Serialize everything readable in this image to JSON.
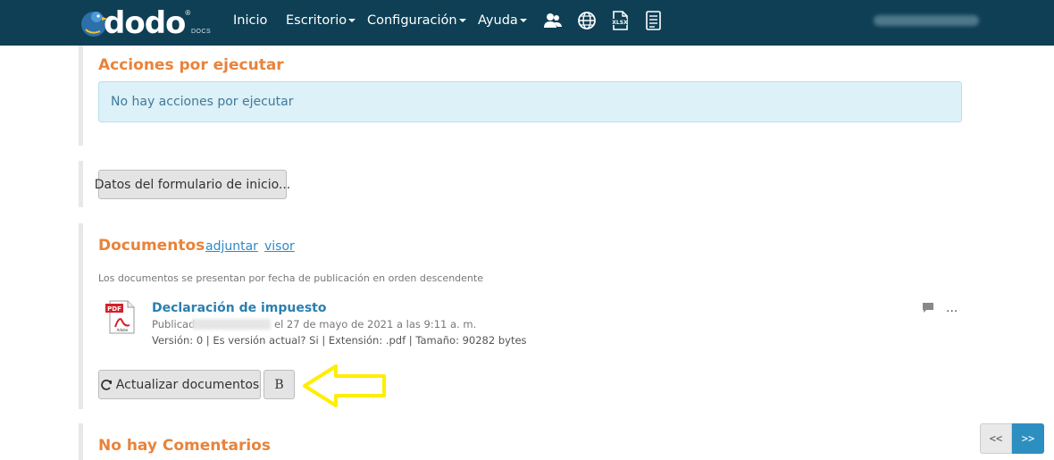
{
  "navbar": {
    "logo_text": "dodo",
    "logo_reg": "®",
    "logo_sub": "DOCS",
    "items": [
      {
        "label": "Inicio",
        "dropdown": false
      },
      {
        "label": "Escritorio",
        "dropdown": true
      },
      {
        "label": "Configuración",
        "dropdown": true
      },
      {
        "label": "Ayuda",
        "dropdown": true
      }
    ],
    "icons": [
      "users-icon",
      "globe-icon",
      "xlsx-icon",
      "document-list-icon"
    ],
    "background": "#0e3f55"
  },
  "acciones": {
    "title": "Acciones por ejecutar",
    "alert": "No hay acciones por ejecutar"
  },
  "form_button": {
    "label": "Datos del formulario de inicio..."
  },
  "documentos": {
    "title": "Documentos",
    "link_attach": "adjuntar",
    "link_viewer": "visor",
    "note": "Los documentos se presentan por fecha de publicación en orden descendente",
    "items": [
      {
        "title": "Declaración de impuesto",
        "published_prefix": "Publicad",
        "published_suffix": "el 27 de mayo de 2021 a las 9:11 a. m.",
        "meta": "Versión: 0 | Es versión actual? Si | Extensión: .pdf | Tamaño: 90282 bytes",
        "more": "..."
      }
    ],
    "refresh_button": "Actualizar documentos",
    "b_button": "B"
  },
  "comentarios": {
    "title": "No hay Comentarios"
  },
  "pager": {
    "prev": "<<",
    "next": ">>"
  },
  "colors": {
    "accent_orange": "#e8833a",
    "link_blue": "#2f8ac6",
    "arrow_yellow": "#ffee00",
    "pager_active": "#2d8fc0"
  }
}
